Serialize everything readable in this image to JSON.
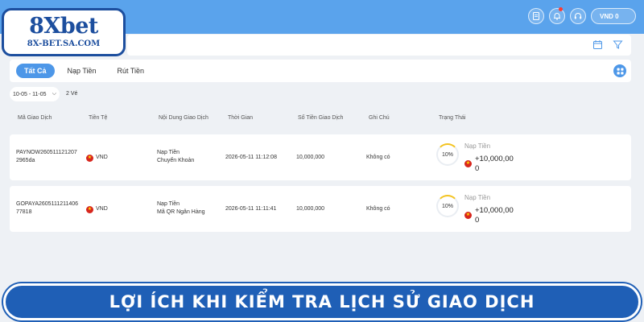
{
  "logo": {
    "main": "8Xbet",
    "sub": "8X-BET.SA.COM"
  },
  "header": {
    "wallet_label": "VND 0",
    "icons": [
      "document-icon",
      "bell-icon",
      "headset-icon"
    ],
    "brand_color": "#5aa3ec"
  },
  "filterbar": {
    "icons": [
      "calendar-icon",
      "filter-icon"
    ]
  },
  "tabs": [
    {
      "label": "Tất Cả",
      "active": true
    },
    {
      "label": "Nạp Tiền",
      "active": false
    },
    {
      "label": "Rút Tiền",
      "active": false
    }
  ],
  "filters": {
    "date_range": "10-05 - 11-05",
    "count": "2 Vé"
  },
  "table": {
    "headers": [
      "Mã Giao Dịch",
      "Tiền Tệ",
      "Nội Dung Giao Dịch",
      "Thời Gian",
      "Số Tiền Giao Dịch",
      "Ghi Chú",
      "Trạng Thái"
    ],
    "rows": [
      {
        "code": "PAYNOW2605111212072965da",
        "currency": "VND",
        "content_line1": "Nạp Tiền",
        "content_line2": "Chuyển Khoản",
        "time": "2026-05-11 11:12:08",
        "amount": "10,000,000",
        "note": "Không có",
        "progress": "10%",
        "status_label": "Nạp Tiền",
        "status_amount": "+10,000,000"
      },
      {
        "code": "GOPAYA260511121140677818",
        "currency": "VND",
        "content_line1": "Nạp Tiền",
        "content_line2": "Mã QR Ngân Hàng",
        "time": "2026-05-11 11:11:41",
        "amount": "10,000,000",
        "note": "Không có",
        "progress": "10%",
        "status_label": "Nạp Tiền",
        "status_amount": "+10,000,000"
      }
    ]
  },
  "banner": {
    "text": "Lợi ích khi kiểm tra lịch sử giao dịch"
  }
}
